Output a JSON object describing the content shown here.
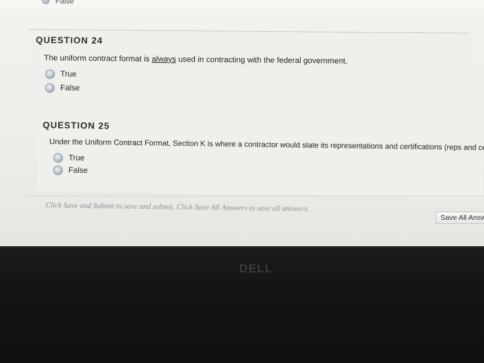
{
  "top": {
    "option_partial": "False"
  },
  "questions": [
    {
      "title": "QUESTION 24",
      "text_before": "The uniform contract format is ",
      "text_emph": "always",
      "text_after": " used in contracting with the federal government.",
      "options": [
        "True",
        "False"
      ]
    },
    {
      "title": "QUESTION 25",
      "text": "Under the Uniform Contract Format, Section K is where a contractor would state its representations and certifications (reps and certs).",
      "options": [
        "True",
        "False"
      ]
    }
  ],
  "footer": {
    "instructions": "Click Save and Submit to save and submit. Click Save All Answers to save all answers.",
    "save_all_label": "Save All Answ"
  },
  "monitor": {
    "brand": "DELL"
  }
}
